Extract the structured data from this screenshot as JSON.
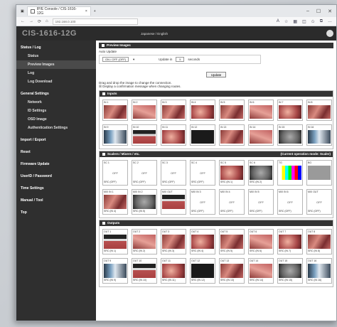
{
  "browser": {
    "tab_title": "IP/E Console / CIS-1616-12G",
    "address": "192.168.0.100",
    "controls": [
      "–",
      "☐",
      "✕"
    ]
  },
  "app": {
    "brand": "CIS-1616-12G",
    "lang": "Japanese / English"
  },
  "sidebar": {
    "items": [
      {
        "label": "Status / Log",
        "level": 0
      },
      {
        "label": "Status",
        "level": 1
      },
      {
        "label": "Preview Images",
        "level": 1,
        "active": true
      },
      {
        "label": "Log",
        "level": 1
      },
      {
        "label": "Log Download",
        "level": 1
      },
      {
        "label": "General Settings",
        "level": 0
      },
      {
        "label": "Network",
        "level": 1
      },
      {
        "label": "ID Settings",
        "level": 1
      },
      {
        "label": "OSD Image",
        "level": 1
      },
      {
        "label": "Authentication Settings",
        "level": 1
      },
      {
        "label": "Import / Export",
        "level": 0
      },
      {
        "label": "Reset",
        "level": 0
      },
      {
        "label": "Firmware Update",
        "level": 0
      },
      {
        "label": "UserID / Password",
        "level": 0
      },
      {
        "label": "Time Settings",
        "level": 0
      },
      {
        "label": "Manual / Tool",
        "level": 0
      },
      {
        "label": "Top",
        "level": 0
      }
    ]
  },
  "preview": {
    "title": "Preview Images",
    "auto_update_label": "Auto Update",
    "mode_value": "ON / OFF (OFF)",
    "interval_prefix": "Update in",
    "interval_value": "5",
    "interval_suffix": "seconds",
    "update_button": "Update",
    "drag_hint": "Drag and drop the image to change the connection.",
    "confirm_hint": "☒ Display a confirmation message when changing routes."
  },
  "inputs": {
    "title": "Inputs",
    "cells": [
      {
        "cap": "IN 1",
        "sw": "s1"
      },
      {
        "cap": "IN 2",
        "sw": "s2"
      },
      {
        "cap": "IN 3",
        "sw": "s1"
      },
      {
        "cap": "IN 4",
        "sw": "s3"
      },
      {
        "cap": "IN 5",
        "sw": "s1"
      },
      {
        "cap": "IN 6",
        "sw": "s2"
      },
      {
        "cap": "IN 7",
        "sw": "s3"
      },
      {
        "cap": "IN 8",
        "sw": "s1"
      },
      {
        "cap": "IN 9",
        "sw": "s4"
      },
      {
        "cap": "IN 10",
        "sw": "s5"
      },
      {
        "cap": "IN 11",
        "sw": "s3"
      },
      {
        "cap": "IN 12",
        "sw": "s9"
      },
      {
        "cap": "IN 13",
        "sw": "s1"
      },
      {
        "cap": "IN 14",
        "sw": "s2"
      },
      {
        "cap": "IN 15",
        "sw": "s6"
      },
      {
        "cap": "IN 16",
        "sw": "s4"
      }
    ]
  },
  "scalers": {
    "title": "Scalers / Mixers / etc.",
    "right": "(Current operation mode: Scaler)",
    "cells": [
      {
        "cap": "SC 1",
        "label": "OFF",
        "src": "SRC (OFF)"
      },
      {
        "cap": "SC 2",
        "label": "OFF",
        "src": "SRC (OFF)"
      },
      {
        "cap": "SC 3",
        "label": "OFF",
        "src": "SRC (OFF)"
      },
      {
        "cap": "SC 4",
        "label": "OFF",
        "src": "SRC (OFF)"
      },
      {
        "cap": "SC 5",
        "sw": "s3",
        "src": "SRC (IN 1)"
      },
      {
        "cap": "SC 6",
        "sw": "s6",
        "src": "SRC (IN 2)"
      },
      {
        "cap": "TG",
        "sw": "s7",
        "src": ""
      },
      {
        "cap": "BG",
        "sw": "s8",
        "src": ""
      },
      {
        "cap": "MIX IN 1",
        "sw": "s1",
        "src": "SRC (IN 4)"
      },
      {
        "cap": "MIX IN 2",
        "sw": "s6",
        "src": "SRC (IN 5)"
      },
      {
        "cap": "MIX OUT",
        "sw": "s5",
        "src": ""
      },
      {
        "cap": "MIX IN 3",
        "label": "OFF",
        "src": "SRC (OFF)"
      },
      {
        "cap": "MIX IN 4",
        "label": "OFF",
        "src": "SRC (OFF)"
      },
      {
        "cap": "MIX IN 5",
        "label": "OFF",
        "src": "SRC (OFF)"
      },
      {
        "cap": "MIX IN 6",
        "label": "OFF",
        "src": "SRC (OFF)"
      },
      {
        "cap": "MIX OUT",
        "label": "OFF",
        "src": "SRC (OFF)"
      }
    ]
  },
  "outputs": {
    "title": "Outputs",
    "cells": [
      {
        "cap": "OUT 1",
        "sw": "s5",
        "src": "SRC (IN 1)"
      },
      {
        "cap": "OUT 2",
        "sw": "s2",
        "src": "SRC (IN 2)"
      },
      {
        "cap": "OUT 3",
        "sw": "s1",
        "src": "SRC (IN 3)"
      },
      {
        "cap": "OUT 4",
        "sw": "s3",
        "src": "SRC (IN 4)"
      },
      {
        "cap": "OUT 5",
        "sw": "s1",
        "src": "SRC (IN 5)"
      },
      {
        "cap": "OUT 6",
        "sw": "s2",
        "src": "SRC (IN 6)"
      },
      {
        "cap": "OUT 7",
        "sw": "s3",
        "src": "SRC (IN 7)"
      },
      {
        "cap": "OUT 8",
        "sw": "s1",
        "src": "SRC (IN 8)"
      },
      {
        "cap": "OUT 9",
        "sw": "s4",
        "src": "SRC (IN 9)"
      },
      {
        "cap": "OUT 10",
        "sw": "s5",
        "src": "SRC (IN 10)"
      },
      {
        "cap": "OUT 11",
        "sw": "s3",
        "src": "SRC (IN 11)"
      },
      {
        "cap": "OUT 12",
        "sw": "s9",
        "src": "SRC (IN 12)"
      },
      {
        "cap": "OUT 13",
        "sw": "s1",
        "src": "SRC (IN 13)"
      },
      {
        "cap": "OUT 14",
        "sw": "s2",
        "src": "SRC (IN 14)"
      },
      {
        "cap": "OUT 15",
        "sw": "s6",
        "src": "SRC (IN 15)"
      },
      {
        "cap": "OUT 16",
        "sw": "s4",
        "src": "SRC (IN 16)"
      }
    ]
  }
}
